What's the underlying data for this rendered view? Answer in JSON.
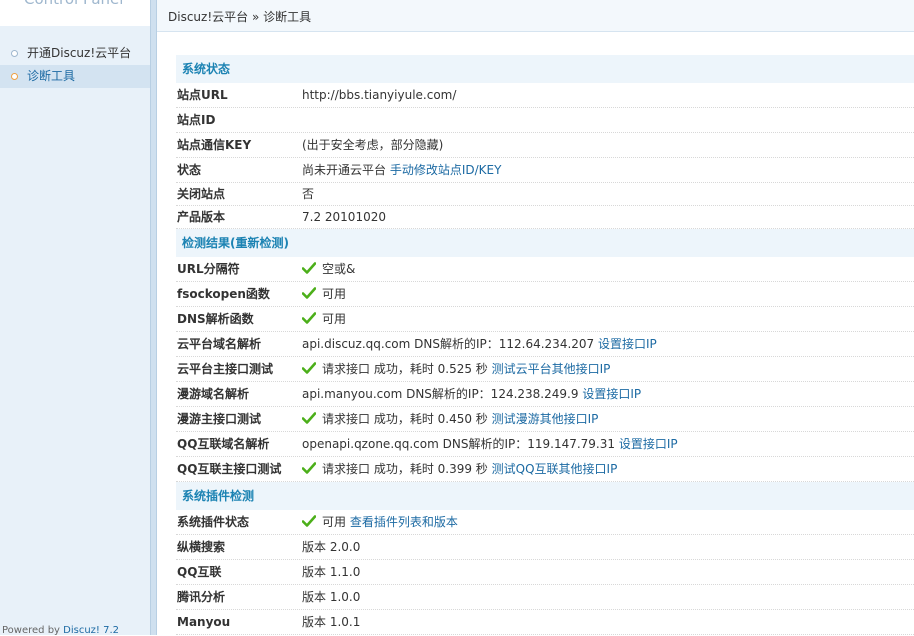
{
  "sidebar": {
    "logo_text": "Control Panel",
    "items": [
      {
        "label": "开通Discuz!云平台",
        "active": false
      },
      {
        "label": "诊断工具",
        "active": true
      }
    ],
    "powered_prefix": "Powered by ",
    "powered_link": "Discuz! 7.2"
  },
  "breadcrumb": {
    "root": "Discuz!云平台",
    "separator": " » ",
    "current": "诊断工具"
  },
  "sections": {
    "status": {
      "title": "系统状态",
      "site_url_label": "站点URL",
      "site_url_value": "http://bbs.tianyiyule.com/",
      "site_id_label": "站点ID",
      "site_id_value": "",
      "site_key_label": "站点通信KEY",
      "site_key_value": "(出于安全考虑，部分隐藏)",
      "state_label": "状态",
      "state_value": "尚未开通云平台",
      "state_link": "手动修改站点ID/KEY",
      "closed_label": "关闭站点",
      "closed_value": "否",
      "version_label": "产品版本",
      "version_value": "7.2 20101020"
    },
    "detect": {
      "title": "检测结果(",
      "recheck_link": "重新检测",
      "title_suffix": ")",
      "url_sep_label": "URL分隔符",
      "url_sep_value": "空或&",
      "fsock_label": "fsockopen函数",
      "fsock_value": "可用",
      "dns_label": "DNS解析函数",
      "dns_value": "可用",
      "cloud_dns_label": "云平台域名解析",
      "cloud_dns_value": "api.discuz.qq.com DNS解析的IP：112.64.234.207",
      "cloud_dns_link": "设置接口IP",
      "cloud_api_label": "云平台主接口测试",
      "cloud_api_value": "请求接口 成功，耗时 0.525 秒",
      "cloud_api_link": "测试云平台其他接口IP",
      "manyou_dns_label": "漫游域名解析",
      "manyou_dns_value": "api.manyou.com DNS解析的IP：124.238.249.9",
      "manyou_dns_link": "设置接口IP",
      "manyou_api_label": "漫游主接口测试",
      "manyou_api_value": "请求接口 成功，耗时 0.450 秒",
      "manyou_api_link": "测试漫游其他接口IP",
      "qq_dns_label": "QQ互联域名解析",
      "qq_dns_value": "openapi.qzone.qq.com DNS解析的IP：119.147.79.31",
      "qq_dns_link": "设置接口IP",
      "qq_api_label": "QQ互联主接口测试",
      "qq_api_value": "请求接口 成功，耗时 0.399 秒",
      "qq_api_link": "测试QQ互联其他接口IP"
    },
    "plugins": {
      "title": "系统插件检测",
      "status_label": "系统插件状态",
      "status_value": "可用",
      "status_link": "查看插件列表和版本",
      "search_label": "纵横搜索",
      "search_value": "版本 2.0.0",
      "qqconnect_label": "QQ互联",
      "qqconnect_value": "版本 1.1.0",
      "tencent_label": "腾讯分析",
      "tencent_value": "版本 1.0.0",
      "manyou_label": "Manyou",
      "manyou_value": "版本 1.0.1"
    }
  },
  "colors": {
    "accent": "#1c83b3",
    "link": "#1c6aa3",
    "check": "#4caf1a",
    "sidebar_bg": "#e8f1f9"
  },
  "icons": {
    "check": "check-icon",
    "bullet": "bullet-icon"
  }
}
